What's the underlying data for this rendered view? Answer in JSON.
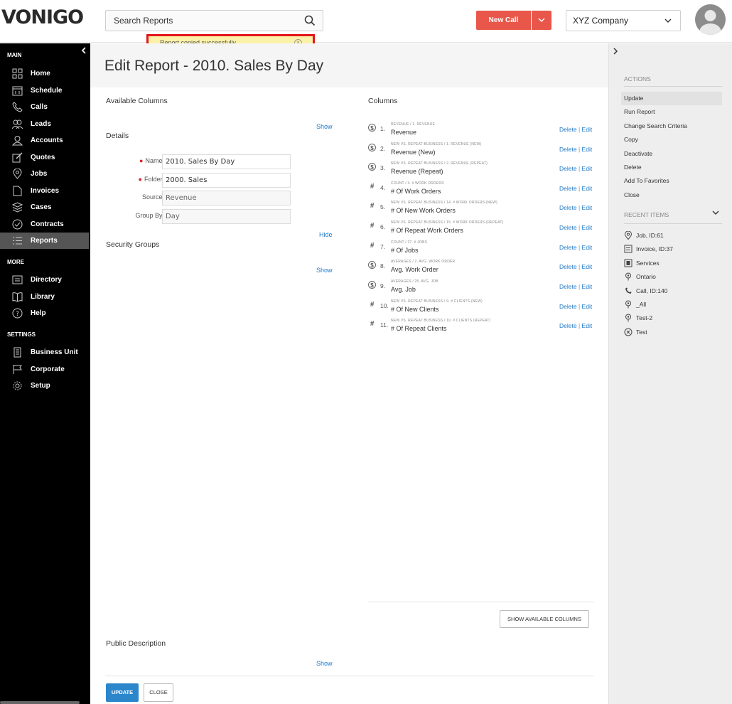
{
  "app": {
    "logo": "VONIGO"
  },
  "header": {
    "search_placeholder": "Search Reports",
    "new_call_label": "New Call",
    "company_label": "XYZ Company"
  },
  "toast": {
    "message": "Report copied successfully."
  },
  "sidebar": {
    "sections": [
      {
        "label": "MAIN",
        "items": [
          {
            "label": "Home",
            "icon": "home-grid-icon"
          },
          {
            "label": "Schedule",
            "icon": "calendar-icon"
          },
          {
            "label": "Calls",
            "icon": "phone-icon"
          },
          {
            "label": "Leads",
            "icon": "users-icon"
          },
          {
            "label": "Accounts",
            "icon": "user-icon"
          },
          {
            "label": "Quotes",
            "icon": "edit-icon"
          },
          {
            "label": "Jobs",
            "icon": "map-pin-icon"
          },
          {
            "label": "Invoices",
            "icon": "document-icon"
          },
          {
            "label": "Cases",
            "icon": "layers-icon"
          },
          {
            "label": "Contracts",
            "icon": "check-circle-icon"
          },
          {
            "label": "Reports",
            "icon": "list-icon",
            "active": true
          }
        ]
      },
      {
        "label": "MORE",
        "items": [
          {
            "label": "Directory",
            "icon": "directory-icon"
          },
          {
            "label": "Library",
            "icon": "book-icon"
          },
          {
            "label": "Help",
            "icon": "help-icon"
          }
        ]
      },
      {
        "label": "SETTINGS",
        "items": [
          {
            "label": "Business Unit",
            "icon": "building-icon"
          },
          {
            "label": "Corporate",
            "icon": "flag-icon"
          },
          {
            "label": "Setup",
            "icon": "gear-icon"
          }
        ]
      }
    ]
  },
  "page": {
    "title": "Edit Report - 2010. Sales By Day"
  },
  "left": {
    "available_columns": "Available Columns",
    "show_1": "Show",
    "details": "Details",
    "fields": [
      {
        "label": "Name:",
        "value": "2010. Sales By Day",
        "required": true
      },
      {
        "label": "Folder:",
        "value": "2000. Sales",
        "required": true
      },
      {
        "label": "Source:",
        "value": "Revenue",
        "required": false
      },
      {
        "label": "Group By:",
        "value": "Day",
        "required": false
      }
    ],
    "hide": "Hide",
    "security_groups": "Security Groups",
    "show_2": "Show",
    "public_description": "Public Description",
    "show_3": "Show"
  },
  "columns": {
    "heading": "Columns",
    "delete_label": "Delete",
    "edit_label": "Edit",
    "separator": "|",
    "items": [
      {
        "num": "1.",
        "icon": "dollar",
        "category": "REVENUE / 1. REVENUE",
        "name": "Revenue"
      },
      {
        "num": "2.",
        "icon": "dollar",
        "category": "NEW VS. REPEAT BUSINESS / 1. REVENUE (NEW)",
        "name": "Revenue (New)"
      },
      {
        "num": "3.",
        "icon": "dollar",
        "category": "NEW VS. REPEAT BUSINESS / 2. REVENUE (REPEAT)",
        "name": "Revenue (Repeat)"
      },
      {
        "num": "4.",
        "icon": "hash",
        "category": "COUNT / 4. # WORK ORDERS",
        "name": "# Of Work Orders"
      },
      {
        "num": "5.",
        "icon": "hash",
        "category": "NEW VS. REPEAT BUSINESS / 14. # WORK ORDERS (NEW)",
        "name": "# Of New Work Orders"
      },
      {
        "num": "6.",
        "icon": "hash",
        "category": "NEW VS. REPEAT BUSINESS / 15. # WORK ORDERS (REPEAT)",
        "name": "# Of Repeat Work Orders"
      },
      {
        "num": "7.",
        "icon": "hash",
        "category": "COUNT / 27. # JOBS",
        "name": "# Of Jobs"
      },
      {
        "num": "8.",
        "icon": "dollar",
        "category": "AVERAGES / 2. AVG. WORK ORDER",
        "name": "Avg. Work Order"
      },
      {
        "num": "9.",
        "icon": "dollar",
        "category": "AVERAGES / 25. AVG. JOB",
        "name": "Avg. Job"
      },
      {
        "num": "10.",
        "icon": "hash",
        "category": "NEW VS. REPEAT BUSINESS / 9. # CLIENTS (NEW)",
        "name": "# Of New Clients"
      },
      {
        "num": "11.",
        "icon": "hash",
        "category": "NEW VS. REPEAT BUSINESS / 10. # CLIENTS (REPEAT)",
        "name": "# Of Repeat Clients"
      }
    ],
    "show_available": "SHOW AVAILABLE COLUMNS"
  },
  "footer": {
    "update": "UPDATE",
    "close": "CLOSE"
  },
  "right": {
    "actions_heading": "ACTIONS",
    "actions": [
      "Update",
      "Run Report",
      "Change Search Criteria",
      "Copy",
      "Deactivate",
      "Delete",
      "Add To Favorites",
      "Close"
    ],
    "recent_heading": "RECENT ITEMS",
    "recent": [
      {
        "label": "Job, ID:61",
        "icon": "map-pin-icon"
      },
      {
        "label": "Invoice, ID:37",
        "icon": "invoice-icon"
      },
      {
        "label": "Services",
        "icon": "service-icon"
      },
      {
        "label": "Ontario",
        "icon": "location-icon"
      },
      {
        "label": "Call, ID:140",
        "icon": "phone-icon"
      },
      {
        "label": "_All",
        "icon": "location-icon"
      },
      {
        "label": "Test-2",
        "icon": "location-icon"
      },
      {
        "label": "Test",
        "icon": "close-circle-icon"
      }
    ]
  },
  "colors": {
    "accent": "#2b86cc",
    "new_call": "#e8574a",
    "toast_bg": "#fcf1a8",
    "toast_border": "#e4141a",
    "sidebar": "#000000"
  }
}
